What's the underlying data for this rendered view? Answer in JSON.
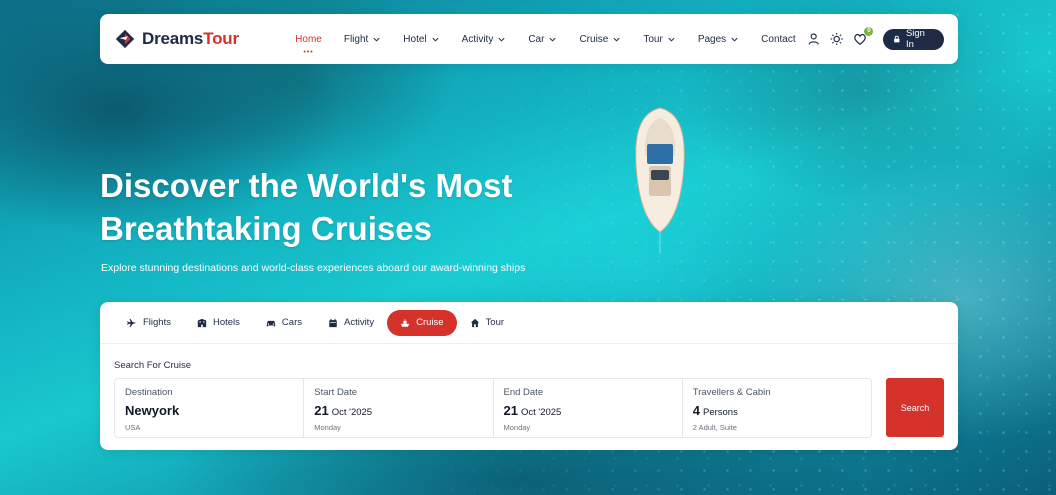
{
  "brand": {
    "name_part1": "Dreams",
    "name_part2": "Tour"
  },
  "nav": [
    {
      "label": "Home",
      "active": true,
      "dropdown": false
    },
    {
      "label": "Flight",
      "dropdown": true
    },
    {
      "label": "Hotel",
      "dropdown": true
    },
    {
      "label": "Activity",
      "dropdown": true
    },
    {
      "label": "Car",
      "dropdown": true
    },
    {
      "label": "Cruise",
      "dropdown": true
    },
    {
      "label": "Tour",
      "dropdown": true
    },
    {
      "label": "Pages",
      "dropdown": true
    },
    {
      "label": "Contact",
      "dropdown": false
    }
  ],
  "header_actions": {
    "icons": [
      "user-icon",
      "sun-icon",
      "heart-icon"
    ],
    "wishlist_count": "0",
    "signin_label": "Sign In"
  },
  "hero": {
    "title_line1": "Discover the World's Most",
    "title_line2": "Breathtaking Cruises",
    "subtitle": "Explore stunning destinations and world-class experiences aboard our award-winning ships"
  },
  "search": {
    "tabs": [
      {
        "label": "Flights",
        "icon": "plane-icon"
      },
      {
        "label": "Hotels",
        "icon": "building-icon"
      },
      {
        "label": "Cars",
        "icon": "car-icon"
      },
      {
        "label": "Activity",
        "icon": "calendar-icon"
      },
      {
        "label": "Cruise",
        "icon": "ship-icon",
        "active": true
      },
      {
        "label": "Tour",
        "icon": "home-icon"
      }
    ],
    "heading": "Search For Cruise",
    "fields": {
      "destination": {
        "label": "Destination",
        "value": "Newyork",
        "hint": "USA"
      },
      "start_date": {
        "label": "Start Date",
        "day": "21",
        "month_year": "Oct '2025",
        "hint": "Monday"
      },
      "end_date": {
        "label": "End Date",
        "day": "21",
        "month_year": "Oct '2025",
        "hint": "Monday"
      },
      "travellers": {
        "label": "Travellers & Cabin",
        "count": "4",
        "unit": "Persons",
        "hint": "2 Adult,  Suite"
      }
    },
    "button_label": "Search"
  },
  "colors": {
    "accent": "#d4322a",
    "dark": "#1f2a44",
    "badge": "#7cb342"
  }
}
